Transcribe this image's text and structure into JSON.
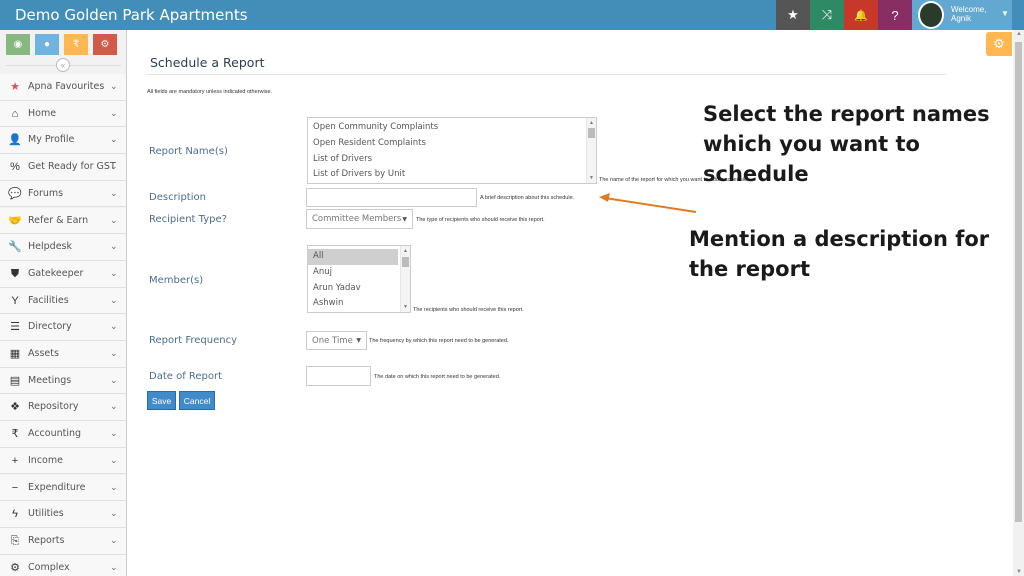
{
  "header": {
    "brand": "Demo Golden Park Apartments",
    "buttons": [
      {
        "name": "favorites-star-button",
        "icon": "★",
        "color": "#555555"
      },
      {
        "name": "shuffle-button",
        "icon": "⤨",
        "color": "#2e8965"
      },
      {
        "name": "notifications-bell-button",
        "icon": "🔔",
        "color": "#c6392a"
      },
      {
        "name": "help-button",
        "icon": "?",
        "color": "#892e65"
      }
    ],
    "welcome": "Welcome,",
    "user": "Agnik"
  },
  "sidebar": {
    "shortcuts": [
      {
        "name": "dashboard-shortcut",
        "icon": "◉",
        "color": "#87b87f"
      },
      {
        "name": "chat-shortcut",
        "icon": "●",
        "color": "#6fb3e0"
      },
      {
        "name": "rupee-shortcut",
        "icon": "₹",
        "color": "#ffb752"
      },
      {
        "name": "settings-shortcut",
        "icon": "⚙",
        "color": "#d15b47"
      }
    ],
    "collapse_icon": "«",
    "items": [
      {
        "label": "Apna Favourites",
        "icon": "★",
        "icon_color": "#d9534f"
      },
      {
        "label": "Home",
        "icon": "⌂",
        "icon_color": "#333333"
      },
      {
        "label": "My Profile",
        "icon": "👤",
        "icon_color": "#333333"
      },
      {
        "label": "Get Ready for GST",
        "icon": "%",
        "icon_color": "#333333"
      },
      {
        "label": "Forums",
        "icon": "💬",
        "icon_color": "#333333"
      },
      {
        "label": "Refer & Earn",
        "icon": "🤝",
        "icon_color": "#333333"
      },
      {
        "label": "Helpdesk",
        "icon": "🔧",
        "icon_color": "#333333"
      },
      {
        "label": "Gatekeeper",
        "icon": "⛊",
        "icon_color": "#333333"
      },
      {
        "label": "Facilities",
        "icon": "Y",
        "icon_color": "#333333"
      },
      {
        "label": "Directory",
        "icon": "☰",
        "icon_color": "#333333"
      },
      {
        "label": "Assets",
        "icon": "▦",
        "icon_color": "#333333"
      },
      {
        "label": "Meetings",
        "icon": "▤",
        "icon_color": "#333333"
      },
      {
        "label": "Repository",
        "icon": "❖",
        "icon_color": "#333333"
      },
      {
        "label": "Accounting",
        "icon": "₹",
        "icon_color": "#333333"
      },
      {
        "label": "Income",
        "icon": "+",
        "icon_color": "#333333"
      },
      {
        "label": "Expenditure",
        "icon": "−",
        "icon_color": "#333333"
      },
      {
        "label": "Utilities",
        "icon": "ϟ",
        "icon_color": "#333333"
      },
      {
        "label": "Reports",
        "icon": "⎘",
        "icon_color": "#333333"
      },
      {
        "label": "Complex",
        "icon": "⚙",
        "icon_color": "#333333"
      }
    ]
  },
  "page": {
    "title": "Schedule a Report",
    "mandatory_note": "All fields are mandatory unless indicated otherwise.",
    "report_names": {
      "label": "Report Name(s)",
      "options": [
        "Open Community Complaints",
        "Open Resident Complaints",
        "List of Drivers",
        "List of Drivers by Unit"
      ],
      "help": "The name of the report for which you want to add a schedule."
    },
    "description": {
      "label": "Description",
      "value": "",
      "help": "A brief description about this schedule."
    },
    "recipient_type": {
      "label": "Recipient Type?",
      "value": "Committee Members",
      "help": "The type of recipients who should receive this report."
    },
    "members": {
      "label": "Member(s)",
      "options": [
        "All",
        "Anuj",
        "Arun Yadav",
        "Ashwin"
      ],
      "selected": "All",
      "help": "The recipients who should receive this report."
    },
    "frequency": {
      "label": "Report Frequency",
      "value": "One Time",
      "help": "The frequency by which this report need to be generated."
    },
    "date": {
      "label": "Date of Report",
      "value": "",
      "help": "The date on which this report need to be generated."
    },
    "save_label": "Save",
    "cancel_label": "Cancel"
  },
  "annotations": {
    "report_names_line1": "Select the report names",
    "report_names_line2": "which you want to schedule",
    "description_line1": "Mention a description for",
    "description_line2": "the report",
    "arrow_color": "#e07b22"
  },
  "colors": {
    "header": "#438eb9",
    "accent": "#428bca",
    "label": "#4e6d8f"
  }
}
